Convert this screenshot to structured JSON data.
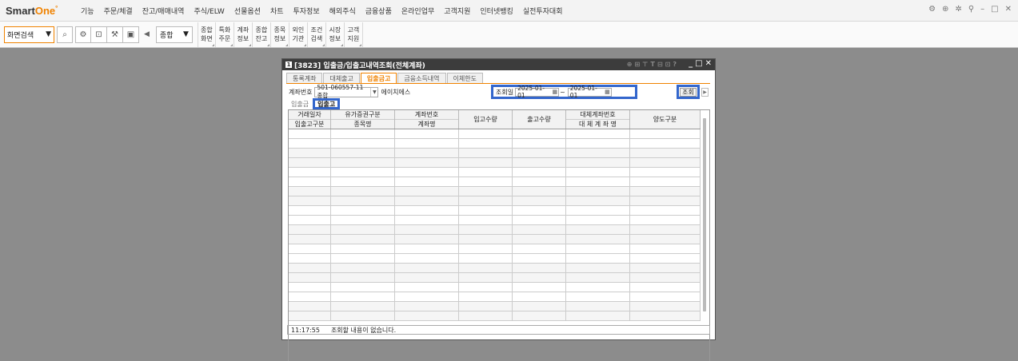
{
  "menubar": {
    "logo_main": "Smart",
    "logo_accent": "One",
    "logo_sup": "°",
    "items": [
      "기능",
      "주문/체결",
      "잔고/매매내역",
      "주식/ELW",
      "선물옵션",
      "차트",
      "투자정보",
      "해외주식",
      "금융상품",
      "온라인업무",
      "고객지원",
      "인터넷뱅킹",
      "실전투자대회"
    ],
    "window_icons": [
      "gear-icon",
      "help-icon",
      "settings-icon",
      "pin-icon"
    ],
    "window_controls": [
      "minimize",
      "maximize",
      "close"
    ]
  },
  "toolbar": {
    "screen_search_label": "화면검색",
    "combo_label": "종합",
    "quick_buttons": [
      [
        "종합",
        "화면"
      ],
      [
        "특화",
        "주문"
      ],
      [
        "계좌",
        "정보"
      ],
      [
        "종합",
        "잔고"
      ],
      [
        "종목",
        "정보"
      ],
      [
        "외인",
        "기관"
      ],
      [
        "조건",
        "검색"
      ],
      [
        "시장",
        "정보"
      ],
      [
        "고객",
        "지원"
      ]
    ]
  },
  "dialog": {
    "title_num": "1",
    "title": "[3823] 입출금/입출고내역조회(전체계좌)",
    "tabs": [
      "통록계좌",
      "대체출고",
      "입출금고",
      "금융소득내역",
      "이체한도"
    ],
    "active_tab": 2,
    "account_label": "계좌번호",
    "account_value": "501-060557-11 종합",
    "account_name": "에이치에스",
    "date_label": "조회일",
    "date_from": "2025-01-01",
    "date_tilde": "~",
    "date_to": "2025-01-01",
    "search_button": "조회",
    "subtabs": [
      "입출금",
      "입출고"
    ],
    "active_subtab": 1,
    "columns": [
      {
        "top": "거래일자",
        "bottom": "입출고구분"
      },
      {
        "top": "유가증권구분",
        "bottom": "종목명"
      },
      {
        "top": "계좌번호",
        "bottom": "계좌명"
      },
      {
        "top": "입고수량",
        "bottom": ""
      },
      {
        "top": "출고수량",
        "bottom": ""
      },
      {
        "top": "대체계좌번호",
        "bottom": "대 체 계 좌 명"
      },
      {
        "top": "양도구분",
        "bottom": ""
      }
    ],
    "status_time": "11:17:55",
    "status_message": "조회할 내용이 없습니다."
  }
}
